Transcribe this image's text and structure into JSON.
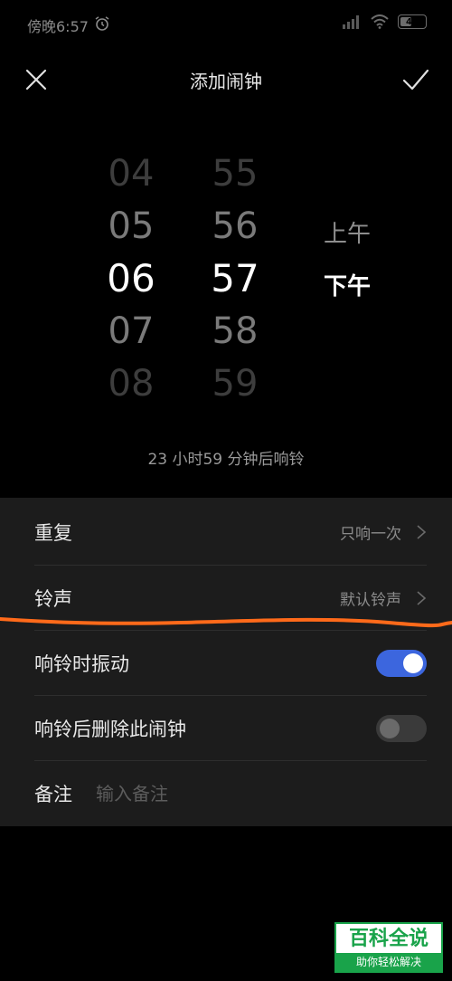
{
  "status_bar": {
    "time": "傍晚6:57",
    "battery": "47",
    "battery_percent": 47
  },
  "header": {
    "title": "添加闹钟"
  },
  "picker": {
    "hours": [
      "04",
      "05",
      "06",
      "07",
      "08"
    ],
    "minutes": [
      "55",
      "56",
      "57",
      "58",
      "59"
    ],
    "am": "上午",
    "pm": "下午",
    "selected_period": "下午"
  },
  "ring_hint": "23 小时59 分钟后响铃",
  "settings": {
    "repeat": {
      "label": "重复",
      "value": "只响一次"
    },
    "ringtone": {
      "label": "铃声",
      "value": "默认铃声"
    },
    "vibrate": {
      "label": "响铃时振动",
      "on": true
    },
    "delete_after": {
      "label": "响铃后删除此闹钟",
      "on": false
    },
    "note": {
      "label": "备注",
      "placeholder": "输入备注",
      "value": ""
    }
  },
  "colors": {
    "accent": "#3c66de",
    "annotation": "#ff6a1a",
    "watermark": "#19a34a"
  },
  "watermark": {
    "main": "百科全说",
    "sub": "助你轻松解决"
  }
}
